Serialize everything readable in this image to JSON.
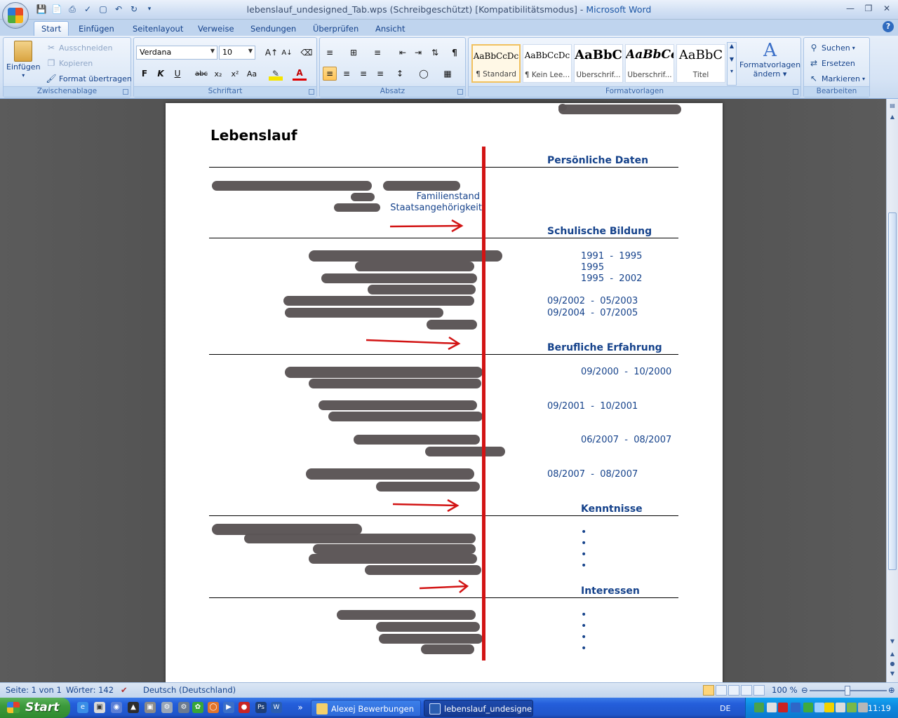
{
  "window": {
    "title": "lebenslauf_undesigned_Tab.wps (Schreibgeschützt) [Kompatibilitätsmodus]",
    "separator": " - ",
    "app": "Microsoft Word"
  },
  "tabs": [
    "Start",
    "Einfügen",
    "Seitenlayout",
    "Verweise",
    "Sendungen",
    "Überprüfen",
    "Ansicht"
  ],
  "ribbon": {
    "clipboard": {
      "label": "Zwischenablage",
      "paste": "Einfügen",
      "cut": "Ausschneiden",
      "copy": "Kopieren",
      "format_painter": "Format übertragen"
    },
    "font": {
      "label": "Schriftart",
      "font_name": "Verdana",
      "font_size": "10"
    },
    "paragraph": {
      "label": "Absatz"
    },
    "styles": {
      "label": "Formatvorlagen",
      "items": [
        {
          "preview": "AaBbCcDc",
          "name": "¶ Standard"
        },
        {
          "preview": "AaBbCcDc",
          "name": "¶ Kein Lee..."
        },
        {
          "preview": "AaBbC",
          "name": "Überschrif..."
        },
        {
          "preview": "AaBbCc",
          "name": "Überschrif..."
        },
        {
          "preview": "AaBbC",
          "name": "Titel"
        }
      ],
      "change_styles_line1": "Formatvorlagen",
      "change_styles_line2": "ändern"
    },
    "editing": {
      "label": "Bearbeiten",
      "find": "Suchen",
      "replace": "Ersetzen",
      "select": "Markieren"
    }
  },
  "document": {
    "title": "Lebenslauf",
    "personal": {
      "heading": "Persönliche Daten",
      "labels": [
        "Familienstand",
        "Staatsangehörigkeit"
      ]
    },
    "school": {
      "heading": "Schulische Bildung",
      "dates": [
        "1991  -  1995",
        "1995",
        "1995  -  2002",
        "09/2002  -  05/2003",
        "09/2004  -  07/2005"
      ]
    },
    "work": {
      "heading": "Berufliche Erfahrung",
      "dates": [
        "09/2000  -  10/2000",
        "09/2001  -  10/2001",
        "06/2007  -  08/2007",
        "08/2007  -  08/2007"
      ]
    },
    "skills": {
      "heading": "Kenntnisse",
      "bullet_count": 4
    },
    "interests": {
      "heading": "Interessen",
      "bullet_count": 4
    }
  },
  "status": {
    "page": "Seite: 1 von 1",
    "words": "Wörter: 142",
    "language": "Deutsch (Deutschland)",
    "zoom": "100 %"
  },
  "taskbar": {
    "start": "Start",
    "tasks": [
      "Alexej Bewerbungen",
      "lebenslauf_undesigne..."
    ],
    "lang": "DE",
    "clock": "11:19"
  },
  "colors": {
    "accent_red": "#d21414",
    "redaction": "#5a5455",
    "ribbon": "#d5e3f5"
  }
}
